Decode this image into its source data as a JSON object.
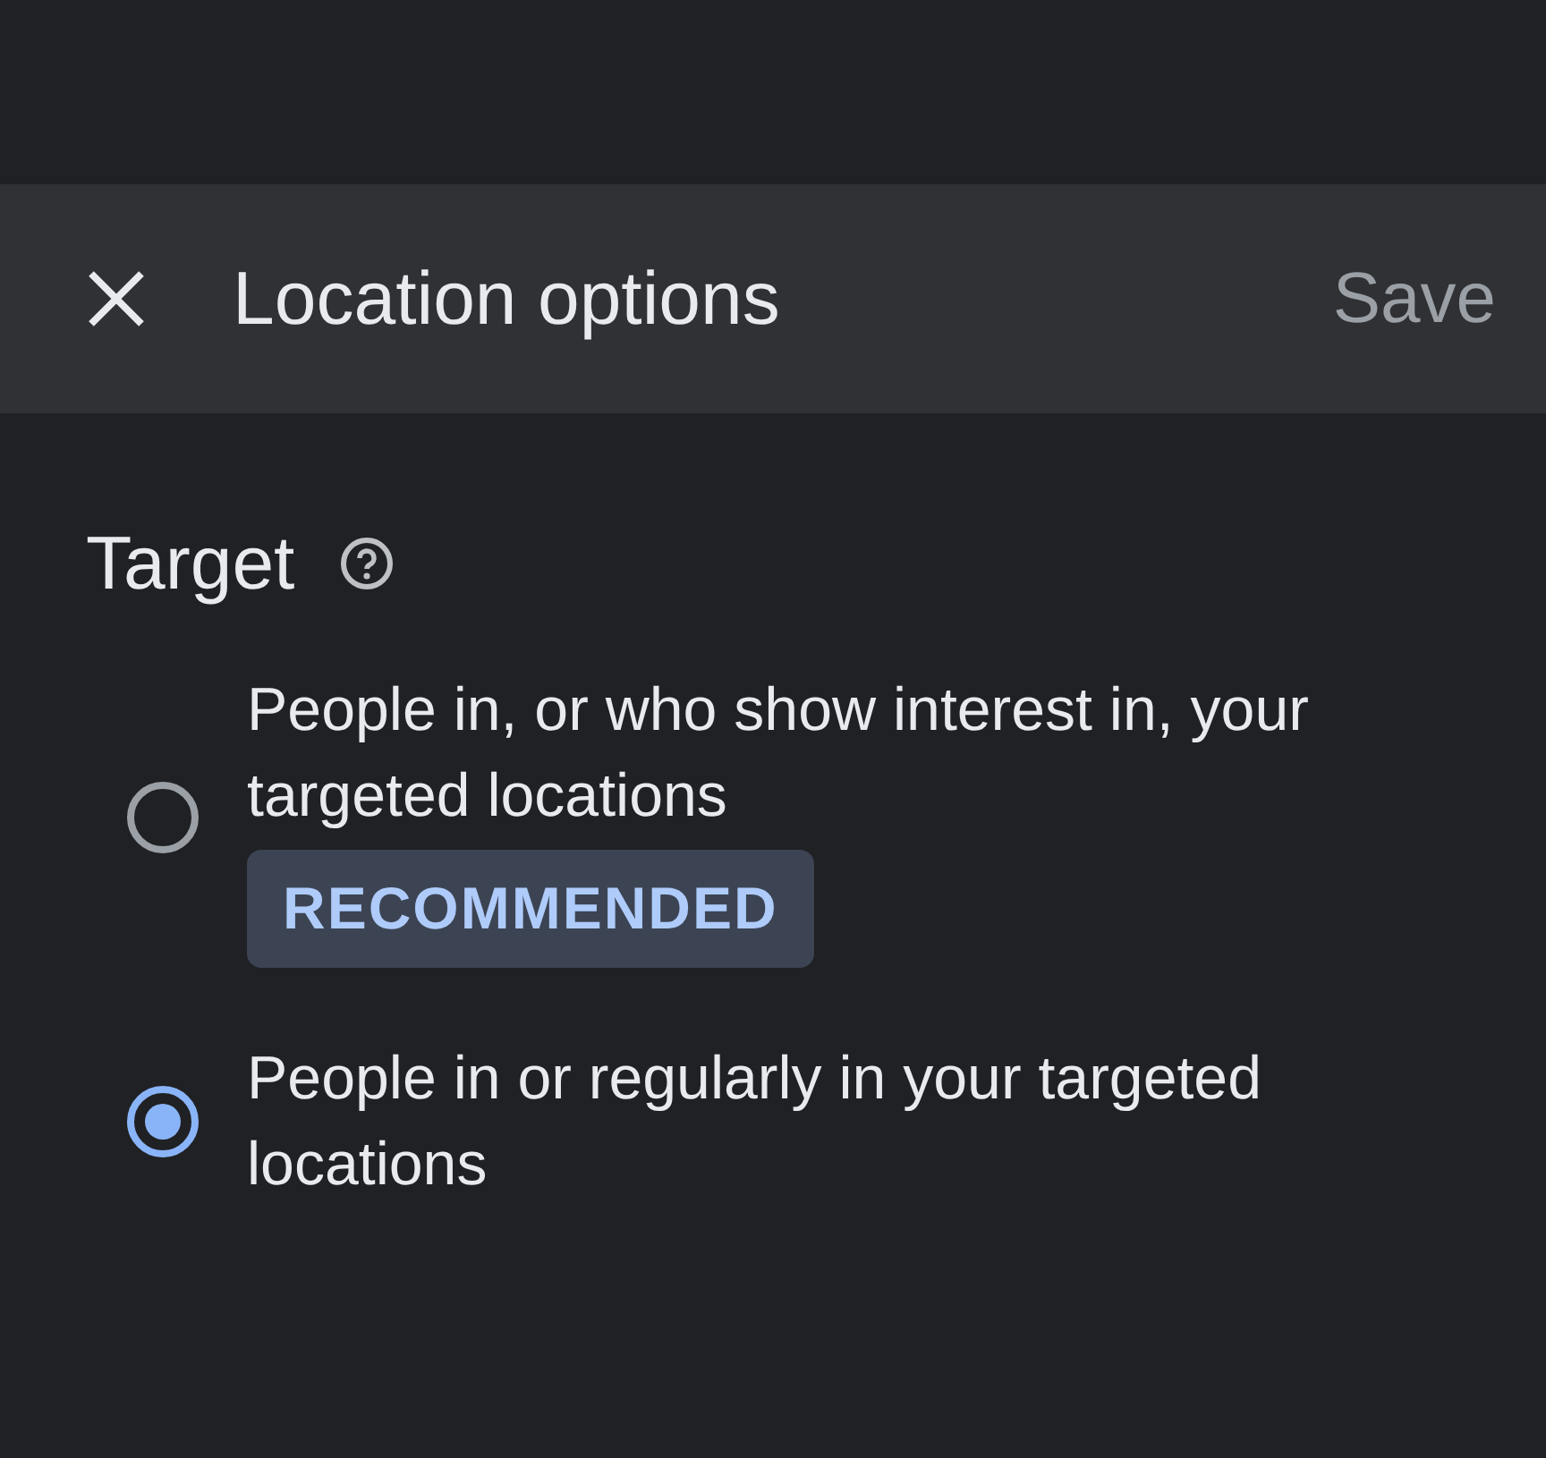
{
  "header": {
    "title": "Location options",
    "save": {
      "label": "Save",
      "disabled": true
    }
  },
  "section": {
    "title": "Target"
  },
  "options": [
    {
      "label": "People in, or who show interest in, your targeted locations",
      "badge": "RECOMMENDED",
      "selected": false
    },
    {
      "label": "People in or regularly in your targeted locations",
      "selected": true
    }
  ]
}
